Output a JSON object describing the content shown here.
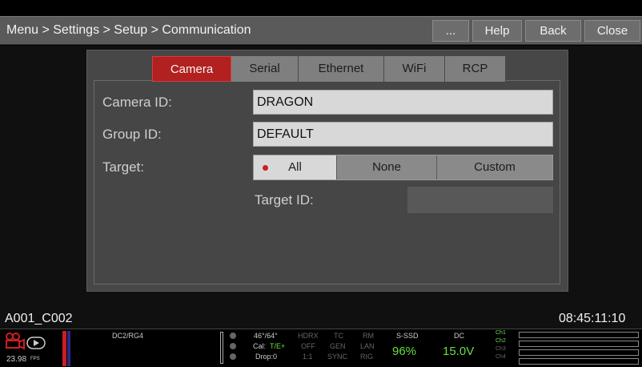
{
  "header": {
    "breadcrumb": "Menu > Settings > Setup > Communication",
    "more_label": "...",
    "help_label": "Help",
    "back_label": "Back",
    "close_label": "Close"
  },
  "tabs": [
    {
      "label": "Camera",
      "active": true
    },
    {
      "label": "Serial",
      "active": false
    },
    {
      "label": "Ethernet",
      "active": false
    },
    {
      "label": "WiFi",
      "active": false
    },
    {
      "label": "RCP",
      "active": false
    }
  ],
  "form": {
    "camera_id_label": "Camera ID:",
    "camera_id_value": "DRAGON",
    "group_id_label": "Group ID:",
    "group_id_value": "DEFAULT",
    "target_label": "Target:",
    "target_options": [
      "All",
      "None",
      "Custom"
    ],
    "target_selected": "All",
    "target_id_label": "Target ID:",
    "target_id_value": ""
  },
  "footer": {
    "clip_name": "A001_C002",
    "timecode": "08:45:11:10",
    "fps": "23.98",
    "fps_unit": "FPS",
    "codec": "DC2/RG4",
    "angle": "46°/64°",
    "cal_prefix": "Cal:",
    "cal_value": "T/E+",
    "drop": "Drop:0",
    "hdrx": "HDRX",
    "hdrx_val": "OFF",
    "ratio": "1:1",
    "tc": "TC",
    "gen": "GEN",
    "sync": "SYNC",
    "rm": "RM",
    "lan": "LAN",
    "rig": "RIG",
    "media_label": "S-SSD",
    "media_value": "96%",
    "power_label": "DC",
    "power_value": "15.0V",
    "channels": [
      "Ch1",
      "Ch2",
      "Ch3",
      "Ch4"
    ]
  },
  "colors": {
    "accent_red": "#b22020",
    "status_green": "#69dd45",
    "header_bg": "#5a5a5a"
  },
  "icons": [
    "camera-icon",
    "play-icon",
    "record-dot-icon"
  ]
}
